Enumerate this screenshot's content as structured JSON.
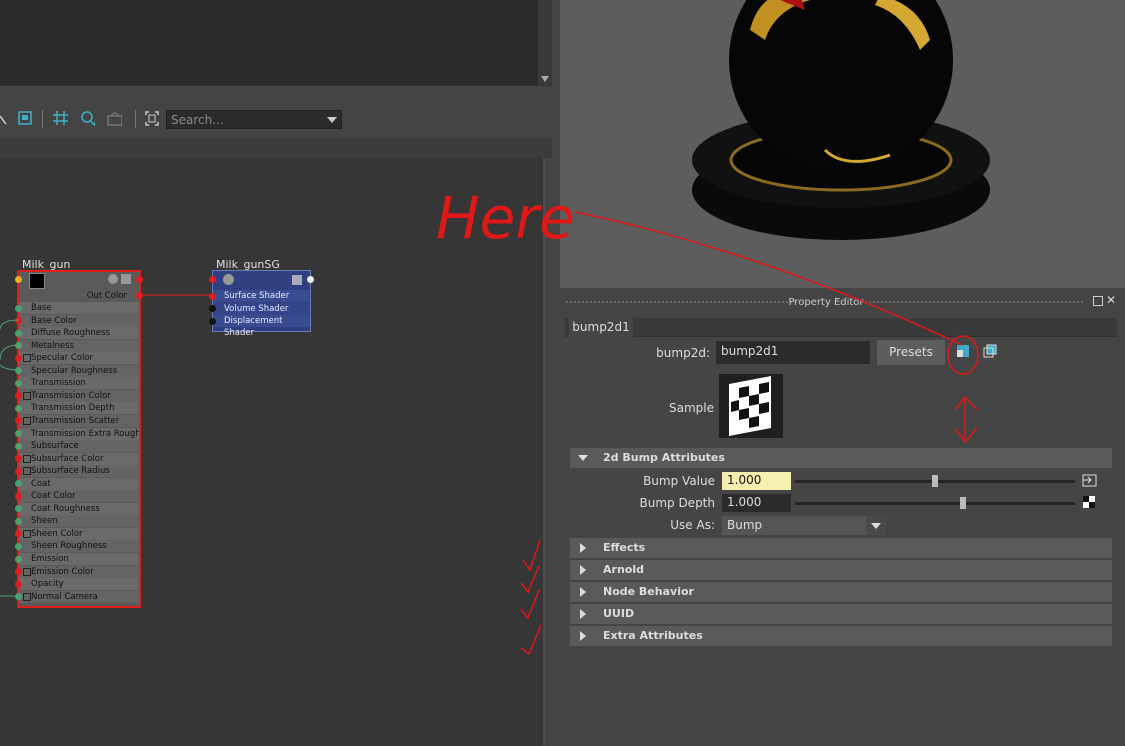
{
  "toolbar": {
    "search_placeholder": "Search..."
  },
  "graph": {
    "milk_node": {
      "title": "Milk_gun",
      "out_label": "Out Color",
      "attributes": [
        "Base",
        "Base Color",
        "Diffuse Roughness",
        "Metalness",
        "Specular Color",
        "Specular Roughness",
        "Transmission",
        "Transmission Color",
        "Transmission Depth",
        "Transmission Scatter",
        "Transmission Extra Roughness",
        "Subsurface",
        "Subsurface Color",
        "Subsurface Radius",
        "Coat",
        "Coat Color",
        "Coat Roughness",
        "Sheen",
        "Sheen Color",
        "Sheen Roughness",
        "Emission",
        "Emission Color",
        "Opacity",
        "Normal Camera"
      ]
    },
    "sg_node": {
      "title": "Milk_gunSG",
      "attributes": [
        "Surface Shader",
        "Volume Shader",
        "Displacement Shader"
      ]
    }
  },
  "property_editor": {
    "title": "Property Editor",
    "tab": "bump2d1",
    "node_type_label": "bump2d:",
    "node_name": "bump2d1",
    "presets_label": "Presets",
    "sample_label": "Sample",
    "sections": {
      "bump_attributes": "2d Bump Attributes",
      "effects": "Effects",
      "arnold": "Arnold",
      "node_behavior": "Node Behavior",
      "uuid": "UUID",
      "extra_attributes": "Extra Attributes"
    },
    "bump_value_label": "Bump Value",
    "bump_value": "1.000",
    "bump_value_slider": 0.5,
    "bump_depth_label": "Bump Depth",
    "bump_depth": "1.000",
    "bump_depth_slider": 0.6,
    "use_as_label": "Use As:",
    "use_as_value": "Bump"
  },
  "annotation": {
    "text": "Here"
  },
  "colors": {
    "selection_red": "#e0201a",
    "sg_blue": "#2f3f7f",
    "bump_value_highlight": "#f5f0b0"
  }
}
